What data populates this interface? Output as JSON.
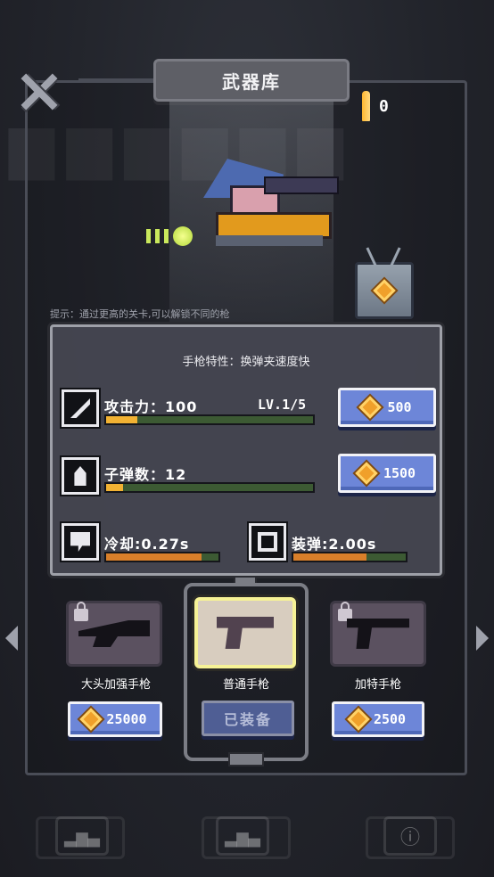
{
  "header": {
    "title": "武器库"
  },
  "ammo": {
    "count": "0"
  },
  "tip": "提示：通过更高的关卡,可以解锁不同的枪",
  "panel": {
    "title": "手枪特性：换弹夹速度快",
    "stats": [
      {
        "label": "攻击力：100",
        "level": "LV.1/5",
        "progress": 0.15,
        "bar_color": "#f2b233",
        "price": "500"
      },
      {
        "label": "子弹数：12",
        "progress": 0.08,
        "bar_color": "#f2b233",
        "price": "1500"
      },
      {
        "label": "冷却:0.27s",
        "progress": 0.85,
        "bar_color": "#d97f2a"
      },
      {
        "label": "装弹:2.00s",
        "progress": 0.65,
        "bar_color": "#d97f2a"
      }
    ]
  },
  "weapons": [
    {
      "name": "大头加强手枪",
      "price": "25000",
      "locked": true
    },
    {
      "name": "普通手枪",
      "status": "已装备",
      "selected": true
    },
    {
      "name": "加特手枪",
      "price": "2500",
      "locked": true
    }
  ],
  "icons": {
    "close": "close-icon",
    "bullet": "bullet-icon",
    "gem": "gem-icon",
    "lock": "lock-icon",
    "arrow_left": "arrow-left-icon",
    "arrow_right": "arrow-right-icon"
  },
  "colors": {
    "button_blue": "#6d86d8",
    "gem_orange": "#f0a02a",
    "selected_border": "#f6f296"
  }
}
